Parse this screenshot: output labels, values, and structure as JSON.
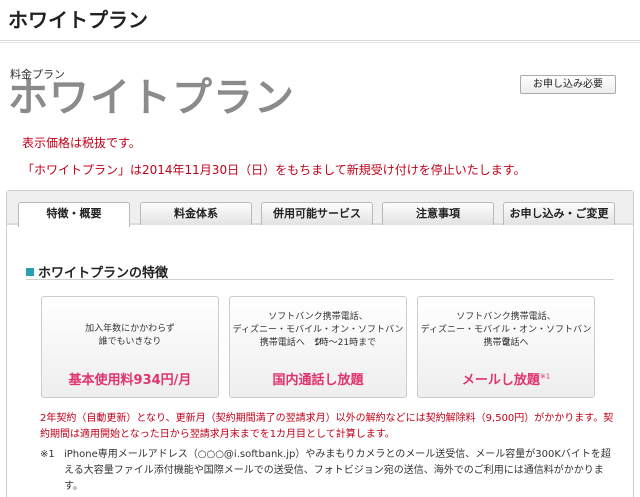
{
  "page": {
    "title": "ホワイトプラン"
  },
  "plan": {
    "category": "料金プラン",
    "logo_text": "ホワイトプラン",
    "apply_button": "お申し込み必要"
  },
  "notices": [
    "表示価格は税抜です。",
    "「ホワイトプラン」は2014年11月30日（日）をもちまして新規受け付けを停止いたします。"
  ],
  "tabs": [
    {
      "label": "特徴・概要",
      "active": true
    },
    {
      "label": "料金体系",
      "active": false
    },
    {
      "label": "併用可能サービス",
      "active": false
    },
    {
      "label": "注意事項",
      "active": false
    },
    {
      "label": "お申し込み・ご変更",
      "active": false
    }
  ],
  "section": {
    "heading": "ホワイトプランの特徴"
  },
  "cards": [
    {
      "desc": [
        "加入年数にかかわらず",
        "誰でもいきなり"
      ],
      "highlight": "基本使用料934円/月",
      "sup": ""
    },
    {
      "desc": [
        "ソフトバンク携帯電話、",
        "ディズニー・モバイル・オン・ソフトバンク",
        "携帯電話へ　1時〜21時まで"
      ],
      "highlight": "国内通話し放題",
      "sup": ""
    },
    {
      "desc": [
        "ソフトバンク携帯電話、",
        "ディズニー・モバイル・オン・ソフトバンク",
        "携帯電話へ"
      ],
      "highlight": "メールし放題",
      "sup": "※1"
    }
  ],
  "contract_note": "2年契約（自動更新）となり、更新月（契約期間満了の翌請求月）以外の解約などには契約解除料（9,500円）がかかります。契約期間は適用開始となった日から翌請求月末までを1カ月目として計算します。",
  "footnote": {
    "mark": "※1",
    "text": "iPhone専用メールアドレス（○○○@i.softbank.jp）やみまもりカメラとのメール送受信、メール容量が300Kバイトを超える大容量ファイル添付機能や国際メールでの送受信、フォトビジョン宛の送信、海外でのご利用には通信料がかかります。"
  },
  "colors": {
    "notice_red": "#c0001a",
    "highlight_pink": "#e0336f",
    "section_marker": "#2aa0b8",
    "logo_gray": "#8b8b8b"
  }
}
